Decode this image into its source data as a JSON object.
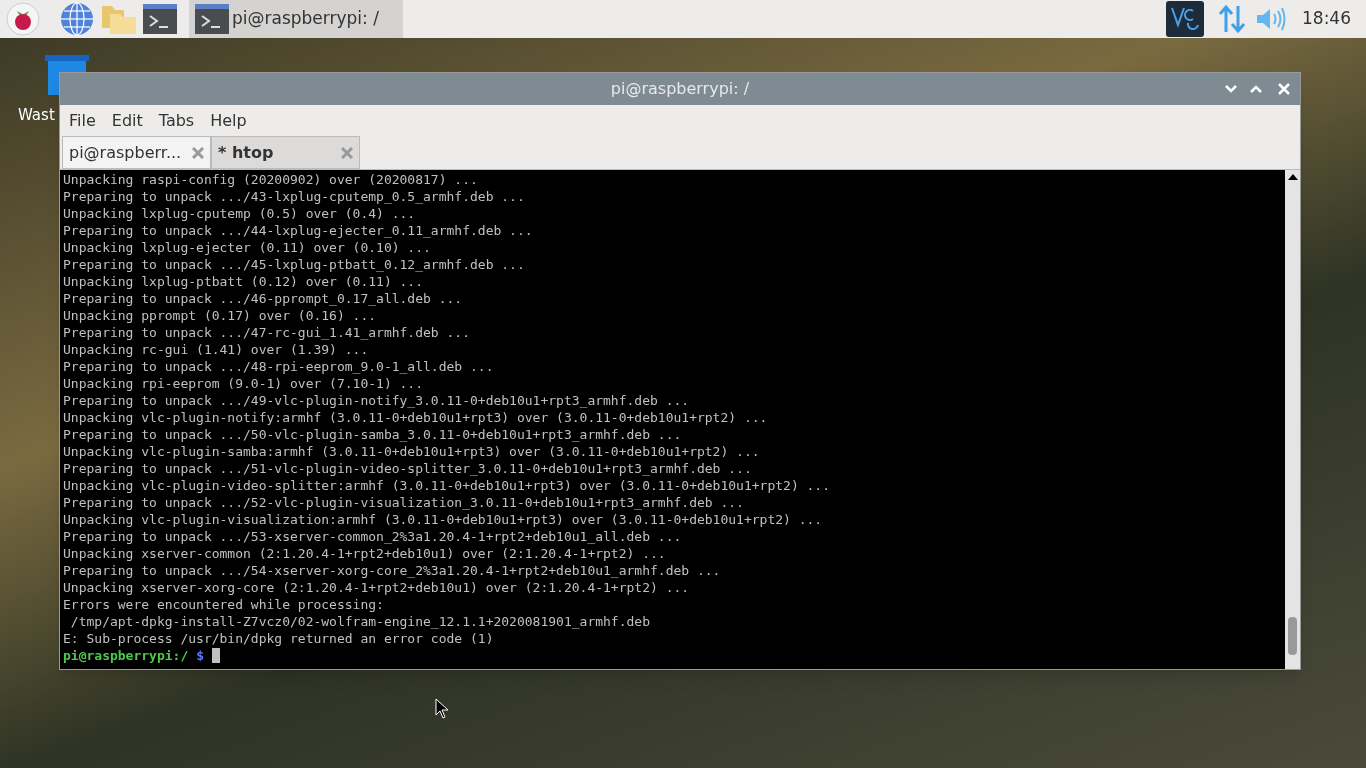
{
  "taskbar": {
    "task": {
      "label": "pi@raspberrypi: /",
      "selected": true
    },
    "clock": "18:46"
  },
  "desktop": {
    "icon_label": "Wast"
  },
  "window": {
    "title": "pi@raspberrypi: /",
    "menu": [
      "File",
      "Edit",
      "Tabs",
      "Help"
    ],
    "tabs": [
      {
        "label": "pi@raspberr...",
        "selected": true
      },
      {
        "label": "* htop",
        "selected": false
      }
    ],
    "terminal": {
      "lines": [
        "Unpacking raspi-config (20200902) over (20200817) ...",
        "Preparing to unpack .../43-lxplug-cputemp_0.5_armhf.deb ...",
        "Unpacking lxplug-cputemp (0.5) over (0.4) ...",
        "Preparing to unpack .../44-lxplug-ejecter_0.11_armhf.deb ...",
        "Unpacking lxplug-ejecter (0.11) over (0.10) ...",
        "Preparing to unpack .../45-lxplug-ptbatt_0.12_armhf.deb ...",
        "Unpacking lxplug-ptbatt (0.12) over (0.11) ...",
        "Preparing to unpack .../46-pprompt_0.17_all.deb ...",
        "Unpacking pprompt (0.17) over (0.16) ...",
        "Preparing to unpack .../47-rc-gui_1.41_armhf.deb ...",
        "Unpacking rc-gui (1.41) over (1.39) ...",
        "Preparing to unpack .../48-rpi-eeprom_9.0-1_all.deb ...",
        "Unpacking rpi-eeprom (9.0-1) over (7.10-1) ...",
        "Preparing to unpack .../49-vlc-plugin-notify_3.0.11-0+deb10u1+rpt3_armhf.deb ...",
        "Unpacking vlc-plugin-notify:armhf (3.0.11-0+deb10u1+rpt3) over (3.0.11-0+deb10u1+rpt2) ...",
        "Preparing to unpack .../50-vlc-plugin-samba_3.0.11-0+deb10u1+rpt3_armhf.deb ...",
        "Unpacking vlc-plugin-samba:armhf (3.0.11-0+deb10u1+rpt3) over (3.0.11-0+deb10u1+rpt2) ...",
        "Preparing to unpack .../51-vlc-plugin-video-splitter_3.0.11-0+deb10u1+rpt3_armhf.deb ...",
        "Unpacking vlc-plugin-video-splitter:armhf (3.0.11-0+deb10u1+rpt3) over (3.0.11-0+deb10u1+rpt2) ...",
        "Preparing to unpack .../52-vlc-plugin-visualization_3.0.11-0+deb10u1+rpt3_armhf.deb ...",
        "Unpacking vlc-plugin-visualization:armhf (3.0.11-0+deb10u1+rpt3) over (3.0.11-0+deb10u1+rpt2) ...",
        "Preparing to unpack .../53-xserver-common_2%3a1.20.4-1+rpt2+deb10u1_all.deb ...",
        "Unpacking xserver-common (2:1.20.4-1+rpt2+deb10u1) over (2:1.20.4-1+rpt2) ...",
        "Preparing to unpack .../54-xserver-xorg-core_2%3a1.20.4-1+rpt2+deb10u1_armhf.deb ...",
        "Unpacking xserver-xorg-core (2:1.20.4-1+rpt2+deb10u1) over (2:1.20.4-1+rpt2) ...",
        "Errors were encountered while processing:",
        " /tmp/apt-dpkg-install-Z7vcz0/02-wolfram-engine_12.1.1+2020081901_armhf.deb",
        "E: Sub-process /usr/bin/dpkg returned an error code (1)"
      ],
      "prompt": {
        "host": "pi@raspberrypi:/",
        "symbol": "$"
      }
    }
  }
}
